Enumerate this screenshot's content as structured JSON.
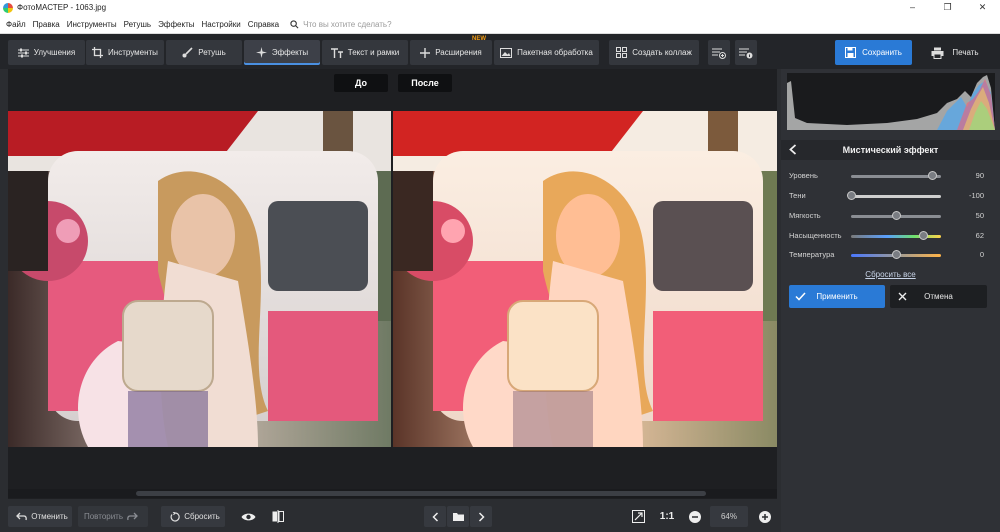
{
  "window": {
    "title": "ФотоМАСТЕР - 1063.jpg",
    "minimize": "–",
    "maximize": "❐",
    "close": "✕"
  },
  "menu": {
    "items": [
      "Файл",
      "Правка",
      "Инструменты",
      "Ретушь",
      "Эффекты",
      "Настройки",
      "Справка"
    ],
    "search_placeholder": "Что вы хотите сделать?"
  },
  "toolbar": {
    "tabs": [
      {
        "label": "Улучшения",
        "icon": "sliders-icon"
      },
      {
        "label": "Инструменты",
        "icon": "crop-icon"
      },
      {
        "label": "Ретушь",
        "icon": "brush-icon"
      },
      {
        "label": "Эффекты",
        "icon": "sparkle-icon",
        "active": true
      },
      {
        "label": "Текст и рамки",
        "icon": "text-icon"
      },
      {
        "label": "Расширения",
        "icon": "plus-icon",
        "badge": "NEW"
      },
      {
        "label": "Пакетная обработка",
        "icon": "image-icon"
      },
      {
        "label": "Создать коллаж",
        "icon": "collage-icon"
      }
    ],
    "save_label": "Сохранить",
    "print_label": "Печать"
  },
  "view": {
    "before_label": "До",
    "after_label": "После"
  },
  "bottom": {
    "undo_label": "Отменить",
    "redo_label": "Повторить",
    "reset_label": "Сбросить",
    "zoom_ratio": "1:1",
    "zoom_value": "64%"
  },
  "panel": {
    "title": "Мистический эффект",
    "sliders": [
      {
        "label": "Уровень",
        "value": 90,
        "min": 0,
        "max": 100,
        "track": "plain"
      },
      {
        "label": "Тени",
        "value": -100,
        "min": -100,
        "max": 100,
        "track": "gray"
      },
      {
        "label": "Мягкость",
        "value": 50,
        "min": 0,
        "max": 100,
        "track": "plain"
      },
      {
        "label": "Насыщенность",
        "value": 62,
        "min": -100,
        "max": 100,
        "track": "saturation"
      },
      {
        "label": "Температура",
        "value": 0,
        "min": -100,
        "max": 100,
        "track": "temperature"
      }
    ],
    "reset_all_label": "Сбросить все",
    "apply_label": "Применить",
    "cancel_label": "Отмена"
  },
  "colors": {
    "accent": "#2a7ad6",
    "background": "#2b2d31",
    "new_badge": "#f39c12"
  }
}
